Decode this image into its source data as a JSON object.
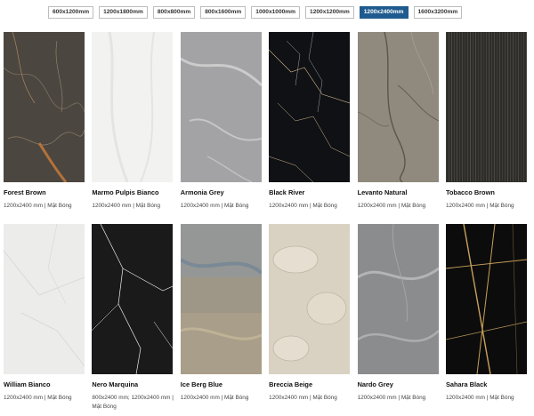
{
  "size_tabs": [
    {
      "label": "600x1200mm",
      "active": false
    },
    {
      "label": "1200x1800mm",
      "active": false
    },
    {
      "label": "800x800mm",
      "active": false
    },
    {
      "label": "800x1600mm",
      "active": false
    },
    {
      "label": "1000x1000mm",
      "active": false
    },
    {
      "label": "1200x1200mm",
      "active": false
    },
    {
      "label": "1200x2400mm",
      "active": true
    },
    {
      "label": "1600x3200mm",
      "active": false
    }
  ],
  "products": [
    {
      "name": "Forest Brown",
      "spec": "1200x2400 mm  |  Mặt Bóng",
      "base": "#4b463f",
      "vein": "#c67a3a",
      "style": "brown"
    },
    {
      "name": "Marmo Pulpis Bianco",
      "spec": "1200x2400 mm  |  Mặt Bóng",
      "base": "#f2f2f1",
      "vein": "#e4e4e2",
      "style": "white"
    },
    {
      "name": "Armonia Grey",
      "spec": "1200x2400 mm  |  Mặt Bóng",
      "base": "#a3a3a5",
      "vein": "#d4d4d6",
      "style": "grey"
    },
    {
      "name": "Black River",
      "spec": "1200x2400 mm  |  Mặt Bóng",
      "base": "#0f1115",
      "vein": "#d6b98b",
      "style": "black"
    },
    {
      "name": "Levanto Natural",
      "spec": "1200x2400 mm  |  Mặt Bóng",
      "base": "#8f8a7d",
      "vein": "#5e5448",
      "style": "levanto"
    },
    {
      "name": "Tobacco Brown",
      "spec": "1200x2400 mm  |  Mặt Bóng",
      "base": "#2e2d29",
      "vein": "#57554d",
      "style": "tobacco"
    },
    {
      "name": "William Bianco",
      "spec": "1200x2400 mm  |  Mặt Bóng",
      "base": "#ececeb",
      "vein": "#d6d6d4",
      "style": "white2"
    },
    {
      "name": "Nero Marquina",
      "spec": "800x2400 mm; 1200x2400 mm  |  Mặt Bóng",
      "base": "#1a1a1a",
      "vein": "#efefef",
      "style": "nero"
    },
    {
      "name": "Ice Berg Blue",
      "spec": "1200x2400 mm  |  Mặt Bóng",
      "base": "#9e9686",
      "vein": "#6f8395",
      "style": "iceberg"
    },
    {
      "name": "Breccia Beige",
      "spec": "1200x2400 mm  |  Mặt Bóng",
      "base": "#d9d2c3",
      "vein": "#bfb6a5",
      "style": "breccia"
    },
    {
      "name": "Nardo Grey",
      "spec": "1200x2400 mm  |  Mặt Bóng",
      "base": "#8b8c8e",
      "vein": "#c4c5c7",
      "style": "nardo"
    },
    {
      "name": "Sahara Black",
      "spec": "1200x2400 mm  |  Mặt Bóng",
      "base": "#0c0c0c",
      "vein": "#c9a15a",
      "style": "sahara"
    }
  ]
}
